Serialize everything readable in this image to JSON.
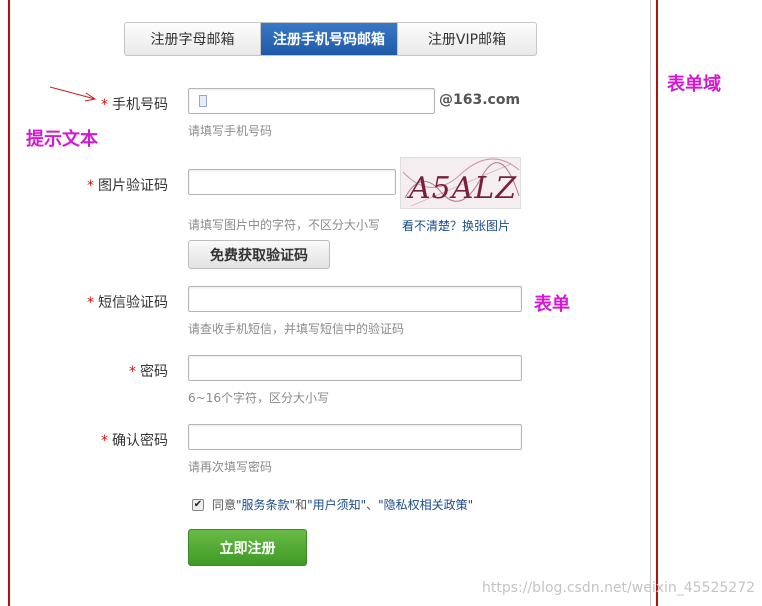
{
  "tabs": [
    {
      "label": "注册字母邮箱"
    },
    {
      "label": "注册手机号码邮箱"
    },
    {
      "label": "注册VIP邮箱"
    }
  ],
  "required_mark": "*",
  "fields": {
    "phone": {
      "label": "手机号码",
      "value": "",
      "hint": "请填写手机号码",
      "domain_suffix": "@163.com"
    },
    "captcha": {
      "label": "图片验证码",
      "value": "",
      "hint": "请填写图片中的字符，不区分大小写",
      "image_text": "A5ALZ",
      "refresh_link": "看不清楚？换张图片"
    },
    "sms": {
      "label": "短信验证码",
      "value": "",
      "hint": "请查收手机短信，并填写短信中的验证码",
      "get_code_button": "免费获取验证码"
    },
    "password": {
      "label": "密码",
      "value": "",
      "hint": "6~16个字符，区分大小写"
    },
    "confirm": {
      "label": "确认密码",
      "value": "",
      "hint": "请再次填写密码"
    }
  },
  "agreement": {
    "checked": true,
    "check_glyph": "✔",
    "prefix": "同意",
    "link1": "\"服务条款\"",
    "and_text": "和",
    "link2": "\"用户须知\"",
    "separator": "、",
    "link3": "\"隐私权相关政策\""
  },
  "submit_button": "立即注册",
  "annotations": {
    "hint_text": "提示文本",
    "form": "表单",
    "form_field": "表单域"
  },
  "watermark": "https://blog.csdn.net/weixin_45525272",
  "colors": {
    "accent_tab": "#1e5aa8",
    "submit_green": "#3e9a25",
    "annotation_magenta": "#d21ad2",
    "frame_red": "#b50e0e",
    "required_red": "#d01010"
  }
}
